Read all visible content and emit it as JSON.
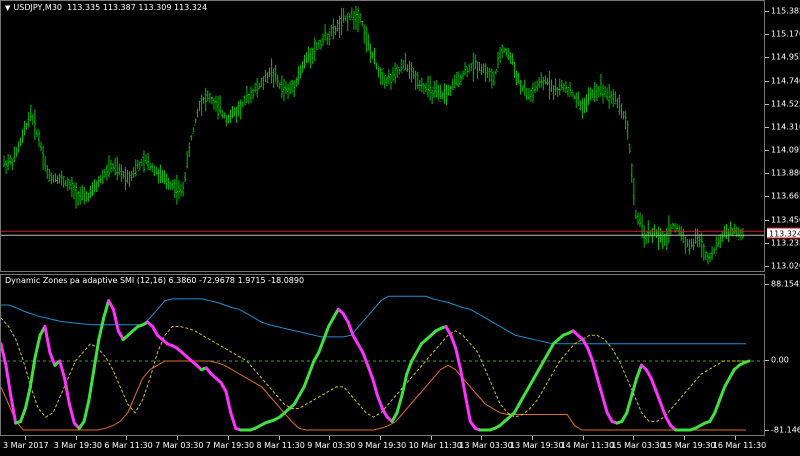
{
  "chart": {
    "symbol_label": "USDJPY,M30",
    "ohlc_label": "113.335 113.387 113.309 113.324",
    "candle_color": "#00c000",
    "bid_line_color": "#d02020",
    "current_price": "113.324"
  },
  "main_scale": {
    "labels": [
      "115.385",
      "115.170",
      "114.955",
      "114.740",
      "114.525",
      "114.310",
      "114.095",
      "113.880",
      "113.665",
      "113.450",
      "113.235",
      "113.020"
    ]
  },
  "indicator": {
    "title": "Dynamic Zones pa adaptive SMI (12,16) 6.3860 -72.9678 1.9715 -18.0890",
    "colors": {
      "up": "#40e040",
      "down": "#ff33ff",
      "upper_zone": "#1e90d0",
      "lower_zone": "#e07018",
      "mid_zone": "#d8c020",
      "zero": "#22aa22"
    }
  },
  "indicator_scale": {
    "labels": [
      "88.1545",
      "0.00",
      "-81.1466"
    ]
  },
  "time_axis": {
    "labels": [
      "3 Mar 2017",
      "3 Mar 19:30",
      "6 Mar 11:30",
      "7 Mar 03:30",
      "7 Mar 19:30",
      "8 Mar 11:30",
      "9 Mar 03:30",
      "9 Mar 19:30",
      "10 Mar 11:30",
      "13 Mar 03:30",
      "13 Mar 19:30",
      "14 Mar 11:30",
      "15 Mar 03:30",
      "15 Mar 19:30",
      "16 Mar 11:30"
    ]
  },
  "chart_data": {
    "type": "line",
    "series_price": [
      113.98,
      114.0,
      114.2,
      114.45,
      114.2,
      113.85,
      113.85,
      113.8,
      113.72,
      113.65,
      113.72,
      113.85,
      113.95,
      113.9,
      113.85,
      113.95,
      114.0,
      113.92,
      113.82,
      113.78,
      113.7,
      114.2,
      114.55,
      114.6,
      114.5,
      114.4,
      114.45,
      114.55,
      114.65,
      114.72,
      114.85,
      114.7,
      114.65,
      114.78,
      114.95,
      115.05,
      115.15,
      115.2,
      115.3,
      115.35,
      115.35,
      115.05,
      114.85,
      114.75,
      114.8,
      114.9,
      114.8,
      114.7,
      114.65,
      114.6,
      114.65,
      114.75,
      114.85,
      114.9,
      114.85,
      114.75,
      115.05,
      114.95,
      114.7,
      114.6,
      114.7,
      114.75,
      114.65,
      114.7,
      114.6,
      114.5,
      114.62,
      114.68,
      114.62,
      114.55,
      114.35,
      113.5,
      113.3,
      113.35,
      113.25,
      113.4,
      113.35,
      113.2,
      113.3,
      113.1,
      113.2,
      113.35,
      113.35,
      113.32
    ],
    "smi": [
      20,
      -5,
      -40,
      -72,
      -70,
      -55,
      -30,
      5,
      30,
      40,
      10,
      -5,
      0,
      -20,
      -50,
      -72,
      -78,
      -70,
      -45,
      -10,
      25,
      50,
      70,
      60,
      35,
      25,
      30,
      35,
      40,
      42,
      45,
      40,
      30,
      25,
      20,
      18,
      15,
      10,
      5,
      0,
      -5,
      -10,
      -8,
      -15,
      -20,
      -25,
      -35,
      -60,
      -78,
      -80,
      -80,
      -80,
      -78,
      -75,
      -72,
      -70,
      -68,
      -65,
      -60,
      -55,
      -50,
      -40,
      -30,
      -15,
      0,
      10,
      25,
      40,
      50,
      60,
      55,
      45,
      30,
      20,
      10,
      -5,
      -20,
      -40,
      -55,
      -65,
      -70,
      -60,
      -40,
      -15,
      0,
      10,
      20,
      25,
      30,
      35,
      38,
      40,
      30,
      15,
      -10,
      -40,
      -70,
      -78,
      -80,
      -80,
      -80,
      -78,
      -75,
      -70,
      -65,
      -60,
      -50,
      -40,
      -30,
      -20,
      -10,
      0,
      10,
      20,
      25,
      30,
      32,
      35,
      30,
      25,
      15,
      0,
      -20,
      -40,
      -60,
      -70,
      -72,
      -70,
      -60,
      -40,
      -20,
      -5,
      -10,
      -20,
      -35,
      -50,
      -65,
      -75,
      -80,
      -80,
      -80,
      -80,
      -78,
      -75,
      -72,
      -70,
      -60,
      -45,
      -30,
      -20,
      -10,
      -5,
      -2,
      0
    ],
    "upper_zone": [
      65,
      65,
      62,
      58,
      55,
      52,
      50,
      48,
      46,
      45,
      44,
      43,
      42,
      42,
      42,
      42,
      42,
      42,
      42,
      42,
      50,
      60,
      70,
      72,
      72,
      72,
      72,
      72,
      70,
      68,
      65,
      62,
      60,
      55,
      50,
      45,
      42,
      40,
      38,
      36,
      34,
      32,
      30,
      28,
      28,
      28,
      28,
      30,
      40,
      50,
      60,
      70,
      75,
      75,
      75,
      75,
      75,
      75,
      72,
      70,
      68,
      65,
      62,
      60,
      55,
      50,
      45,
      40,
      35,
      30,
      28,
      26,
      24,
      22,
      20,
      20,
      20,
      20,
      20,
      20,
      20,
      20,
      20,
      20,
      20,
      20,
      20,
      20,
      20,
      20,
      20,
      20,
      20,
      20,
      20,
      20,
      20,
      20,
      20,
      20,
      20
    ],
    "lower_zone": [
      -30,
      -50,
      -70,
      -80,
      -80,
      -80,
      -80,
      -80,
      -80,
      -80,
      -80,
      -80,
      -80,
      -80,
      -78,
      -75,
      -70,
      -60,
      -40,
      -20,
      -10,
      -5,
      0,
      0,
      0,
      0,
      0,
      0,
      0,
      -2,
      -5,
      -10,
      -15,
      -20,
      -25,
      -30,
      -40,
      -50,
      -60,
      -70,
      -78,
      -80,
      -80,
      -80,
      -80,
      -80,
      -80,
      -80,
      -80,
      -80,
      -80,
      -78,
      -75,
      -70,
      -60,
      -50,
      -40,
      -30,
      -20,
      -10,
      -5,
      -10,
      -20,
      -30,
      -40,
      -50,
      -55,
      -60,
      -62,
      -62,
      -62,
      -62,
      -62,
      -62,
      -62,
      -62,
      -62,
      -75,
      -80,
      -80,
      -80,
      -80,
      -80,
      -80,
      -80,
      -80,
      -80,
      -80,
      -80,
      -80,
      -80,
      -80,
      -80,
      -80,
      -80,
      -80,
      -80,
      -80,
      -80,
      -80,
      -80
    ],
    "mid_zone": [
      50,
      40,
      25,
      0,
      -30,
      -55,
      -65,
      -60,
      -40,
      -20,
      0,
      10,
      20,
      15,
      5,
      -10,
      -30,
      -50,
      -60,
      -45,
      -20,
      10,
      30,
      40,
      40,
      38,
      35,
      30,
      25,
      20,
      15,
      10,
      5,
      0,
      -10,
      -20,
      -30,
      -40,
      -50,
      -55,
      -55,
      -50,
      -45,
      -40,
      -35,
      -30,
      -30,
      -40,
      -50,
      -60,
      -65,
      -60,
      -50,
      -40,
      -30,
      -20,
      -10,
      0,
      10,
      20,
      30,
      35,
      30,
      20,
      10,
      -10,
      -30,
      -50,
      -60,
      -65,
      -62,
      -55,
      -45,
      -30,
      -15,
      0,
      10,
      20,
      25,
      30,
      30,
      25,
      15,
      0,
      -20,
      -40,
      -60,
      -70,
      -70,
      -65,
      -55,
      -45,
      -35,
      -25,
      -15,
      -10,
      -5,
      0,
      0,
      0,
      0
    ],
    "ylim_price": [
      113.02,
      115.385
    ],
    "ylim_indicator": [
      -81.1466,
      88.1545
    ]
  }
}
